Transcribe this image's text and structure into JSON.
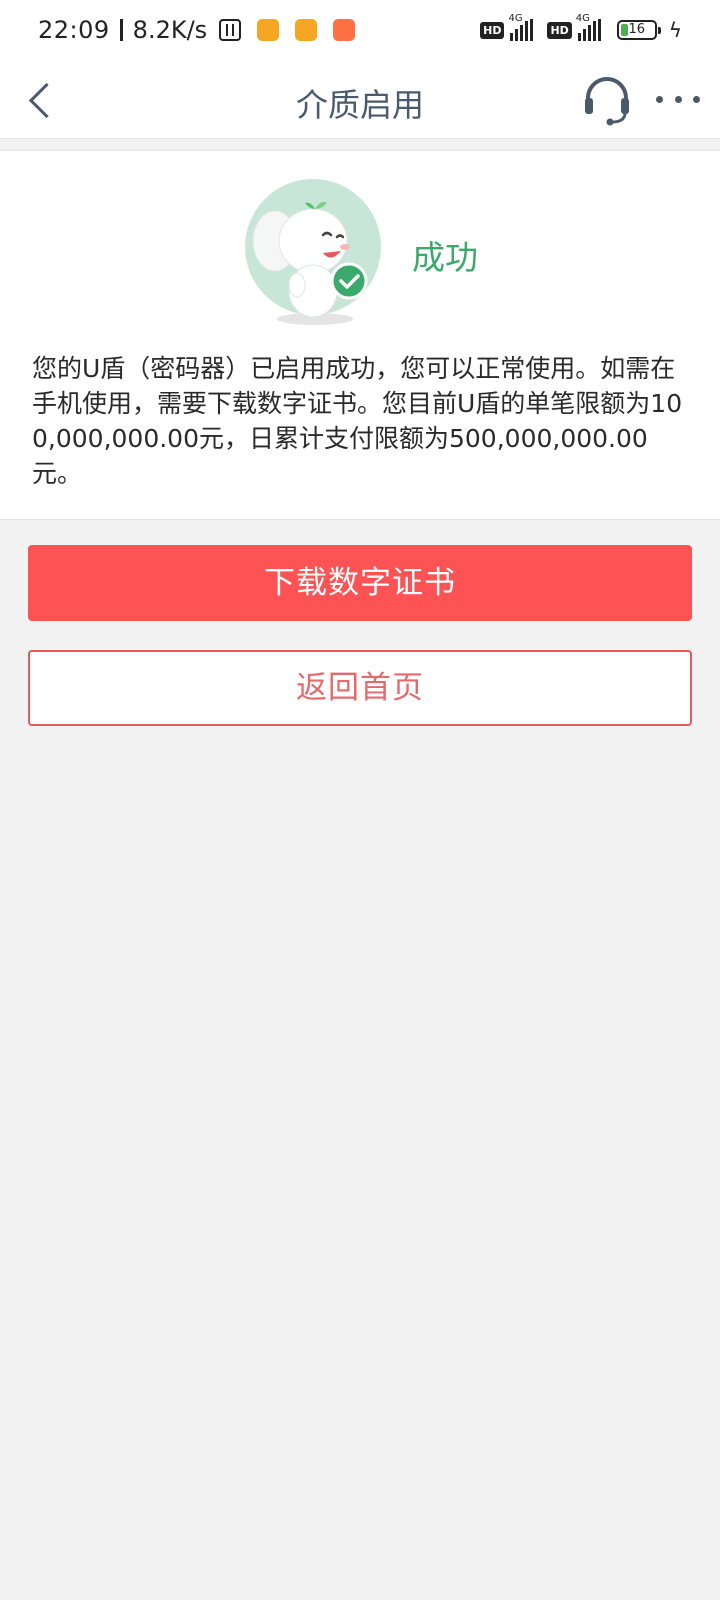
{
  "status_bar": {
    "time": "22:09",
    "network_speed": "8.2K/s",
    "sim1_type": "HD",
    "sim1_network": "4G",
    "sim2_type": "HD",
    "sim2_network": "4G",
    "battery_level": "16",
    "app_icon_colors": [
      "#f5a623",
      "#f5a623",
      "#ff7043"
    ]
  },
  "header": {
    "title": "介质启用",
    "back_icon": "chevron-left-icon",
    "support_icon": "headset-icon",
    "more_icon": "more-dots-icon"
  },
  "result": {
    "mascot_icon": "elephant-mascot-success-icon",
    "status": "成功",
    "status_color": "#3aaa6a",
    "message": "您的U盾（密码器）已启用成功，您可以正常使用。如需在手机使用，需要下载数字证书。您目前U盾的单笔限额为100,000,000.00元，日累计支付限额为500,000,000.00元。"
  },
  "actions": {
    "download_label": "下载数字证书",
    "home_label": "返回首页",
    "primary_color": "#fe5355"
  }
}
